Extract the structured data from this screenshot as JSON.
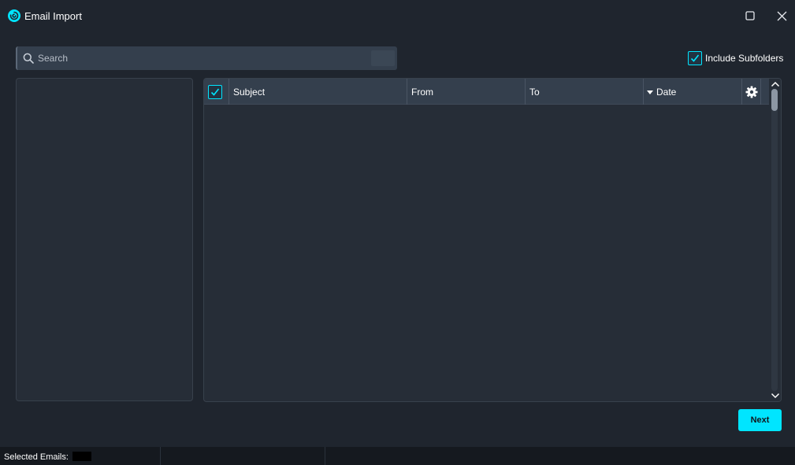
{
  "window": {
    "title": "Email Import",
    "logo_icon": "app-swirl-icon",
    "maximize_icon": "maximize-icon",
    "close_icon": "close-icon"
  },
  "search": {
    "placeholder": "Search",
    "value": ""
  },
  "include_subfolders": {
    "label": "Include Subfolders",
    "checked": true
  },
  "email_table": {
    "select_all_checked": true,
    "columns": [
      "Subject",
      "From",
      "To",
      "Date"
    ],
    "sort_column": "Date",
    "sort_direction": "descending",
    "settings_icon": "gear-icon",
    "rows": []
  },
  "footer": {
    "next_label": "Next"
  },
  "status": {
    "selected_emails_label": "Selected Emails:",
    "selected_emails_value": ""
  },
  "colors": {
    "accent": "#00e5ff",
    "background": "#1f252e",
    "panel": "#262d37",
    "header": "#343f4d"
  }
}
